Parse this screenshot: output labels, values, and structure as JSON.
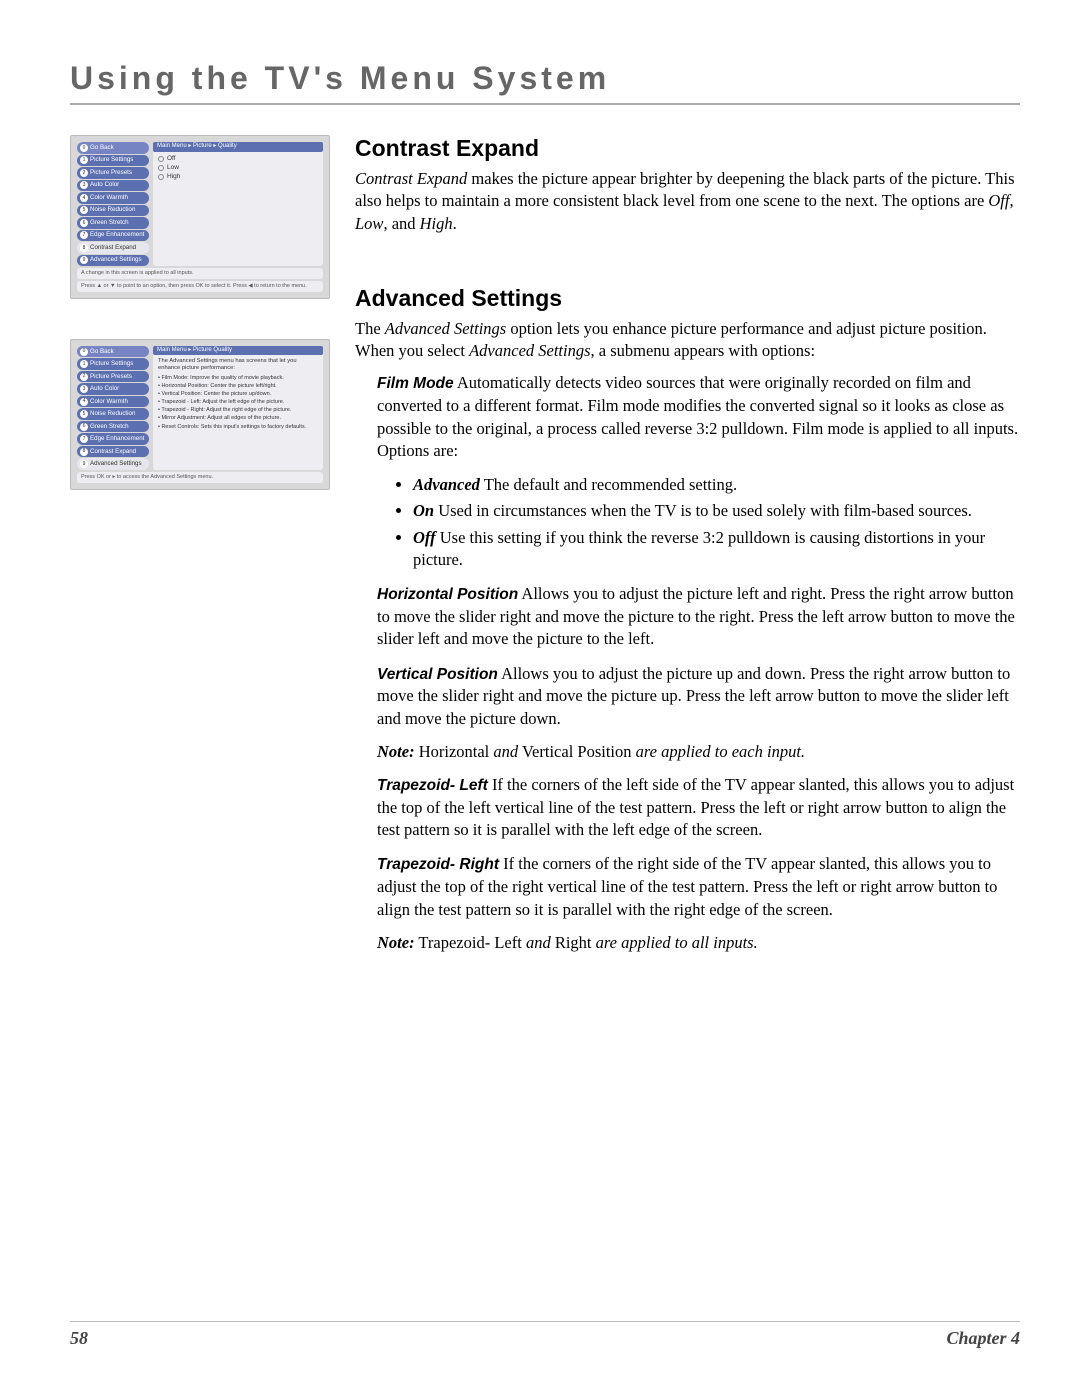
{
  "page_title": "Using the TV's Menu System",
  "footer": {
    "page_number": "58",
    "chapter": "Chapter 4"
  },
  "figure1": {
    "crumb": "Main Menu ▸ Picture ▸ Quality",
    "menu": [
      {
        "n": "0",
        "label": "Go Back",
        "v": "sel2"
      },
      {
        "n": "1",
        "label": "Picture Settings"
      },
      {
        "n": "2",
        "label": "Picture Presets"
      },
      {
        "n": "3",
        "label": "Auto Color"
      },
      {
        "n": "4",
        "label": "Color Warmth"
      },
      {
        "n": "5",
        "label": "Noise Reduction"
      },
      {
        "n": "6",
        "label": "Green Stretch"
      },
      {
        "n": "7",
        "label": "Edge Enhancement"
      },
      {
        "n": "8",
        "label": "Contrast Expand",
        "v": "sel"
      },
      {
        "n": "9",
        "label": "Advanced Settings"
      }
    ],
    "options": [
      "Off",
      "Low",
      "High"
    ],
    "help1": "A change in this screen is applied to all inputs.",
    "help2": "Press ▲ or ▼ to point to an option, then press OK to select it. Press ◀ to return to the menu."
  },
  "figure2": {
    "crumb": "Main Menu ▸ Picture Quality",
    "menu": [
      {
        "n": "0",
        "label": "Go Back",
        "v": "sel2"
      },
      {
        "n": "1",
        "label": "Picture Settings"
      },
      {
        "n": "2",
        "label": "Picture Presets"
      },
      {
        "n": "3",
        "label": "Auto Color"
      },
      {
        "n": "4",
        "label": "Color Warmth"
      },
      {
        "n": "5",
        "label": "Noise Reduction"
      },
      {
        "n": "6",
        "label": "Green Stretch"
      },
      {
        "n": "7",
        "label": "Edge Enhancement"
      },
      {
        "n": "8",
        "label": "Contrast Expand"
      },
      {
        "n": "9",
        "label": "Advanced Settings",
        "v": "sel"
      }
    ],
    "desc_intro": "The Advanced Settings menu has screens that let you enhance picture performance:",
    "desc_items": [
      "• Film Mode: Improve the quality of movie playback.",
      "• Horizontal Position: Center the picture left/right.",
      "• Vertical Position: Center the picture up/down.",
      "• Trapezoid - Left: Adjust the left edge of the picture.",
      "• Trapezoid - Right: Adjust the right edge of the picture.",
      "• Mirror Adjustment: Adjust all edges of the picture.",
      "• Reset Controls: Sets this input's settings to factory defaults."
    ],
    "help": "Press OK or ▸ to access the Advanced Settings menu."
  },
  "section_ce": {
    "heading": "Contrast Expand",
    "p1a": "Contrast Expand",
    "p1b": " makes the picture appear brighter by deepening the black parts of the picture. This also helps to maintain a more consistent black level from one scene to the next. The options are ",
    "opt1": "Off",
    "s1": ", ",
    "opt2": "Low",
    "s2": ", and ",
    "opt3": "High",
    "s3": "."
  },
  "section_as": {
    "heading": "Advanced Settings",
    "p1a": "The ",
    "p1b": "Advanced Settings",
    "p1c": " option lets you enhance picture performance and adjust picture position. When you select ",
    "p1d": "Advanced Settings",
    "p1e": ", a submenu appears with options:",
    "film": {
      "label": "Film Mode",
      "text": "   Automatically detects video sources that were originally recorded on film and converted to a different format. Film mode modifies the converted signal so it looks as close as possible to the original, a process called reverse 3:2 pulldown. Film mode is applied to all inputs. Options are:",
      "bullets": [
        {
          "label": "Advanced",
          "text": "   The default and recommended setting."
        },
        {
          "label": "On",
          "text": "   Used in circumstances when the TV is to be used solely with film-based sources."
        },
        {
          "label": "Off",
          "text": "   Use this setting if you think the reverse 3:2 pulldown is causing distortions in your picture."
        }
      ]
    },
    "hpos": {
      "label": "Horizontal Position",
      "text": "   Allows you to adjust the picture left and right. Press the right arrow button to move the slider right and move the picture to the right. Press the left arrow button to move the slider left and move the picture to the left."
    },
    "vpos": {
      "label": "Vertical Position",
      "text": "   Allows you to adjust the picture up and down. Press the right arrow button to move the slider right and move the picture up. Press the left arrow button to move the slider left and move the picture down."
    },
    "note1a": "Note:",
    "note1b": " Horizontal ",
    "note1c": "and",
    "note1d": " Vertical Position ",
    "note1e": "are applied to each input.",
    "tleft": {
      "label": "Trapezoid- Left",
      "text": "   If the corners of the left side of the TV appear slanted, this allows you to adjust the top of the left vertical line of the test pattern. Press the left or right arrow button to align the test pattern so it is parallel with the left edge of the screen."
    },
    "tright": {
      "label": "Trapezoid- Right",
      "text": "   If the corners of the right side of the TV appear slanted, this allows you to adjust the top of the right vertical line of the test pattern. Press the left or right arrow button to align the test pattern so it is parallel with the right edge of the screen."
    },
    "note2a": "Note:",
    "note2b": " Trapezoid- Left ",
    "note2c": "and",
    "note2d": " Right ",
    "note2e": "are applied to all inputs."
  }
}
